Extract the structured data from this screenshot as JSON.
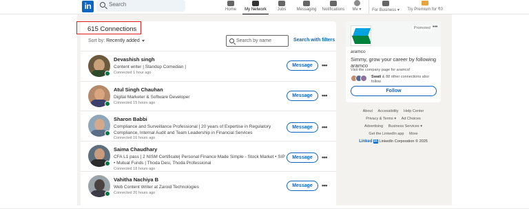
{
  "nav": {
    "logo": "in",
    "search_placeholder": "Search",
    "items": [
      {
        "label": "Home"
      },
      {
        "label": "My Network"
      },
      {
        "label": "Jobs"
      },
      {
        "label": "Messaging"
      },
      {
        "label": "Notifications"
      },
      {
        "label": "Me ▾"
      },
      {
        "label": "For Business ▾"
      },
      {
        "label": "Try Premium for ₹0"
      }
    ]
  },
  "connections": {
    "count_label": "615 Connections",
    "sort_prefix": "Sort by:",
    "sort_value": "Recently added",
    "search_placeholder": "Search by name",
    "filters_link": "Search with filters",
    "message_label": "Message",
    "more_label": "•••",
    "rows": [
      {
        "name": "Devashish singh",
        "headline": "Content writer | Standup Comedian |",
        "connected": "Connected 1 hour ago"
      },
      {
        "name": "Atul Singh Chauhan",
        "headline": "Digital Marketer & Software Developer",
        "connected": "Connected 15 hours ago"
      },
      {
        "name": "Sharon Babbi",
        "headline": "Compliance and Surveillance Professional | 20 years of Expertise in Regulatory Compliance, Internal Audit and Team Leadership in Financial Services",
        "connected": "Connected 16 hours ago"
      },
      {
        "name": "Saima Chaudhary",
        "headline": "CFA L1 pass | 2 NISM Certificate| Personal Finance Made Simple - Stock Market • SIP • Mutual Funds | Thoda Desi, Thoda Professional",
        "connected": "Connected 18 hours ago"
      },
      {
        "name": "Vahitha Nachiya B",
        "headline": "Web Content Writer at Zaroid Technologies",
        "connected": "Connected 20 hours ago"
      }
    ]
  },
  "ad": {
    "promoted_label": "Promoted",
    "more_label": "•••",
    "company": "aramco",
    "text": "Simmy, grow your career by following aramco",
    "sub": "Visit the company page for aramco!",
    "social_name": "Swati",
    "social_rest": "& 88 other connections also follow",
    "follow_label": "Follow"
  },
  "footer": {
    "row1": [
      "About",
      "Accessibility",
      "Help Center"
    ],
    "row2": [
      "Privacy & Terms ▾",
      "Ad Choices"
    ],
    "row3": [
      "Advertising",
      "Business Services ▾"
    ],
    "row4": [
      "Get the LinkedIn app",
      "More"
    ],
    "brand_a": "Linked",
    "brand_b": "in",
    "copyright": "LinkedIn Corporation © 2025"
  }
}
